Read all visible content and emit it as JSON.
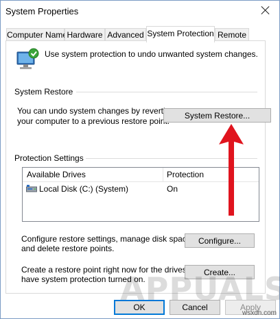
{
  "window": {
    "title": "System Properties"
  },
  "tabs": [
    {
      "label": "Computer Name",
      "active": false
    },
    {
      "label": "Hardware",
      "active": false
    },
    {
      "label": "Advanced",
      "active": false
    },
    {
      "label": "System Protection",
      "active": true
    },
    {
      "label": "Remote",
      "active": false
    }
  ],
  "intro": {
    "text": "Use system protection to undo unwanted system changes.",
    "icon": "computer-shield-icon"
  },
  "system_restore": {
    "group_label": "System Restore",
    "desc_line1": "You can undo system changes by reverting",
    "desc_line2": "your computer to a previous restore point.",
    "button_label": "System Restore..."
  },
  "protection_settings": {
    "group_label": "Protection Settings",
    "columns": [
      "Available Drives",
      "Protection"
    ],
    "rows": [
      {
        "drive": "Local Disk (C:) (System)",
        "protection": "On",
        "icon": "hard-disk-icon"
      }
    ],
    "configure_line1": "Configure restore settings, manage disk space,",
    "configure_line2": "and delete restore points.",
    "configure_button": "Configure...",
    "create_line1": "Create a restore point right now for the drives that",
    "create_line2": "have system protection turned on.",
    "create_button": "Create..."
  },
  "footer": {
    "ok": "OK",
    "cancel": "Cancel",
    "apply": "Apply"
  },
  "watermark": {
    "text": "APPUALS",
    "corner": "wsxdn.com"
  },
  "colors": {
    "annotation_arrow": "#e0141e",
    "default_button_border": "#0078d7"
  }
}
